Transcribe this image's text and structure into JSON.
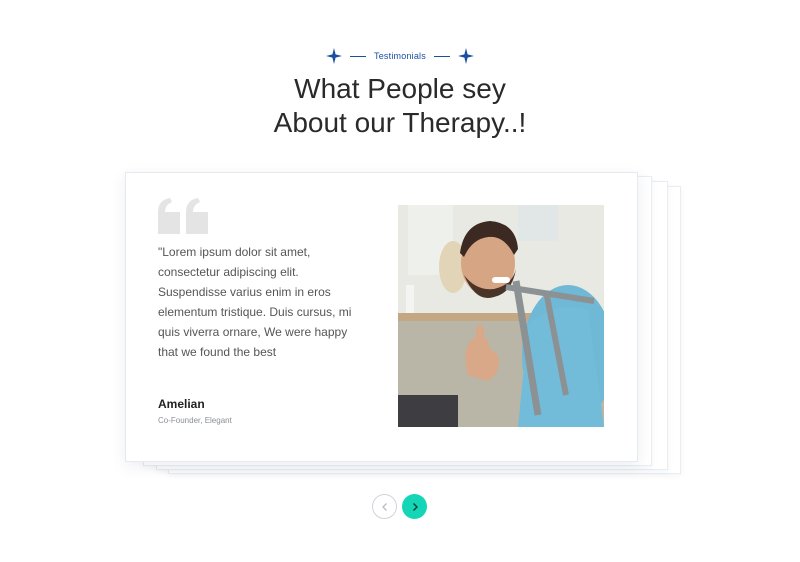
{
  "section": {
    "eyebrow": "Testimonials",
    "title_line1": "What People sey",
    "title_line2": "About our Therapy..!"
  },
  "testimonial": {
    "quote": "\"Lorem ipsum dolor sit amet, consectetur adipiscing elit. Suspendisse varius enim in eros elementum tristique. Duis cursus, mi quis viverra ornare, We were happy that we found the best",
    "author_name": "Amelian",
    "author_role": "Co-Founder, Elegant",
    "photo_alt": "Smiling patient with crutch giving thumbs up"
  },
  "navigation": {
    "prev_icon": "chevron-left-icon",
    "next_icon": "chevron-right-icon"
  },
  "colors": {
    "accent": "#1a4fa0",
    "nav_active": "#14d6b7",
    "quote_mark": "#e6e6e6"
  }
}
